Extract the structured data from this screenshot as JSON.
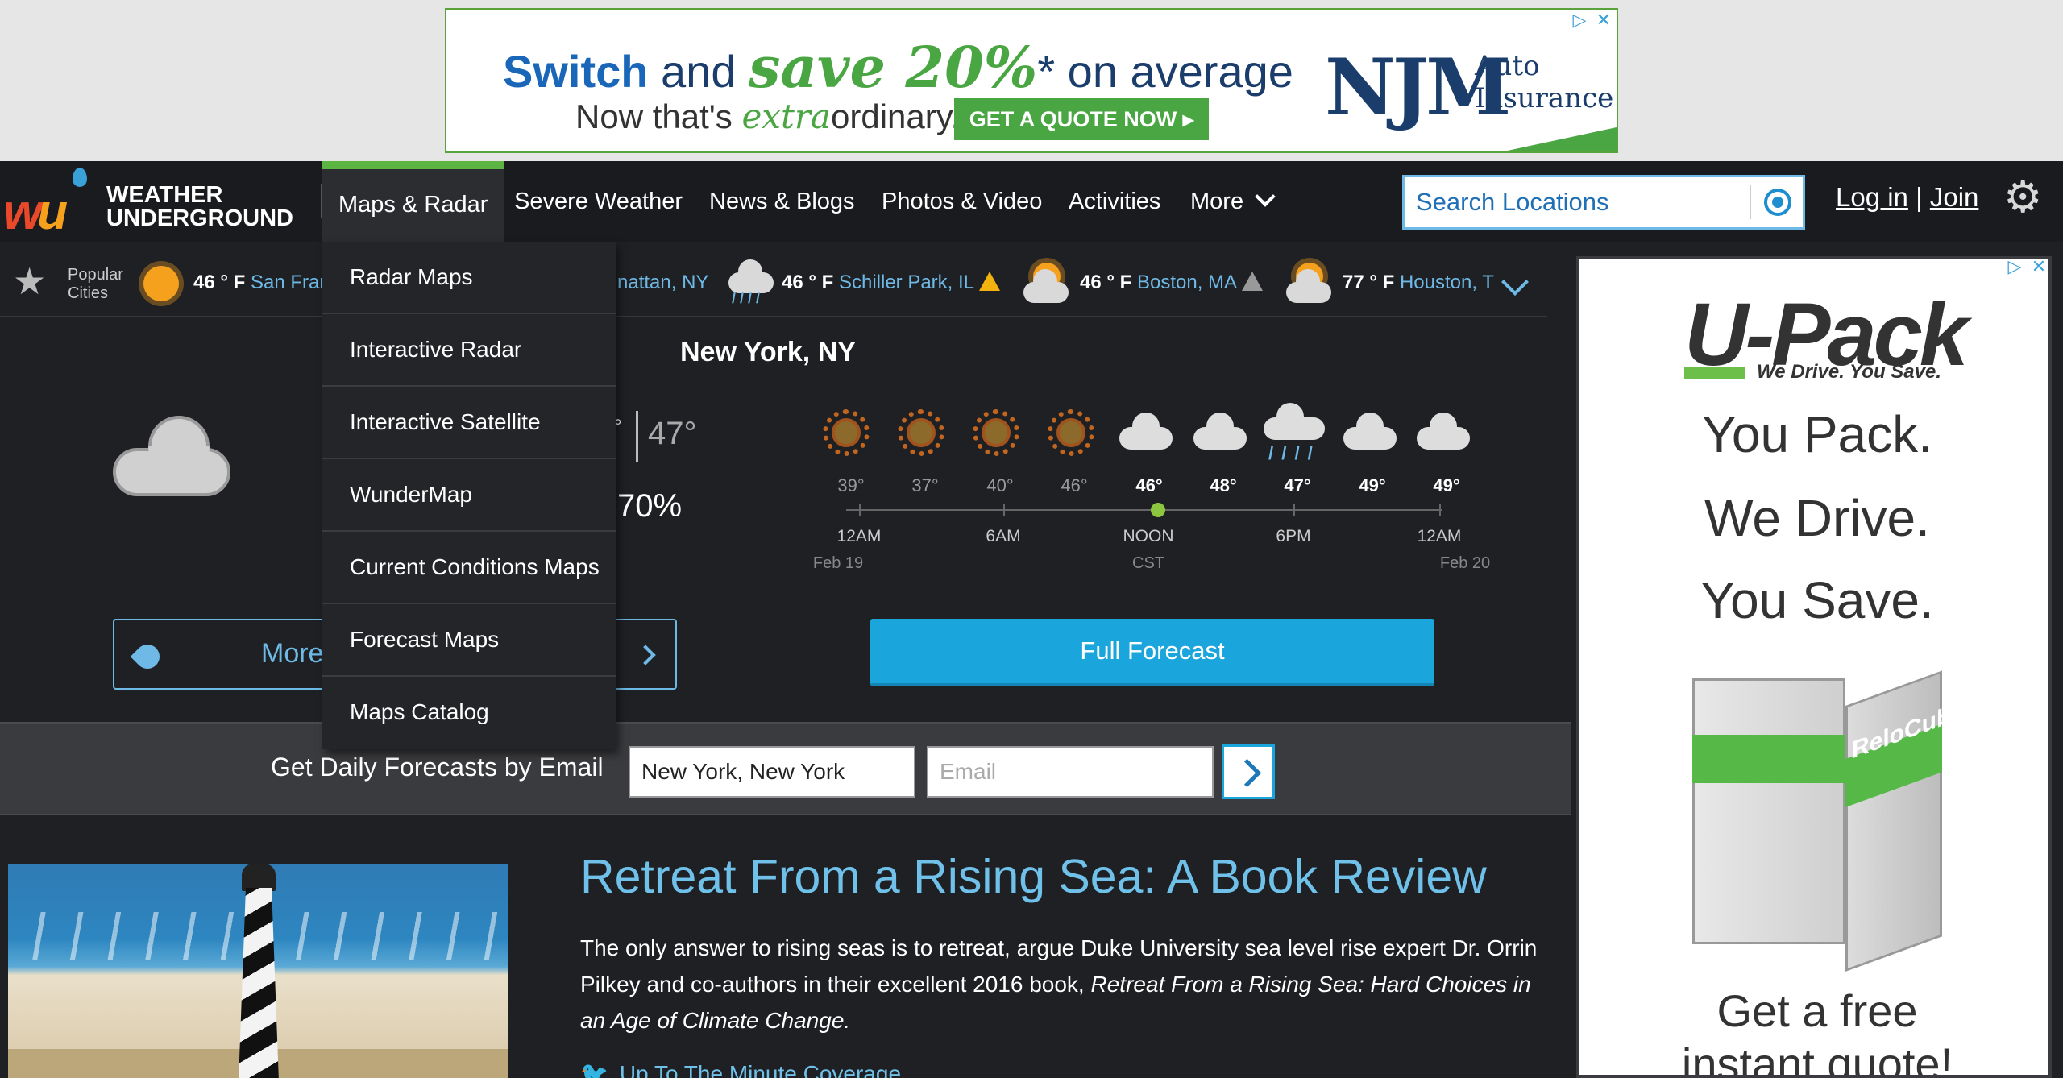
{
  "top_ad": {
    "headline_pre": "Switch",
    "headline_mid": " and ",
    "headline_save": "save 20%",
    "headline_star": "*",
    "headline_post": " on average",
    "subline_pre": "Now that's ",
    "subline_it": "extra",
    "subline_post": "ordinary.",
    "cta": "GET A QUOTE NOW ▸",
    "brand": "NJM",
    "brand_line1": "Auto",
    "brand_line2": "Insurance"
  },
  "logo": {
    "line1": "WEATHER",
    "line2": "UNDERGROUND"
  },
  "nav": {
    "items": [
      {
        "label": "Maps & Radar",
        "active": true
      },
      {
        "label": "Severe Weather"
      },
      {
        "label": "News & Blogs"
      },
      {
        "label": "Photos & Video"
      },
      {
        "label": "Activities"
      },
      {
        "label": "More"
      }
    ],
    "search_placeholder": "Search Locations",
    "login": "Log in",
    "sep": " | ",
    "join": "Join"
  },
  "popular": {
    "label_line1": "Popular",
    "label_line2": "Cities",
    "cities": [
      {
        "temp": "46 ° F",
        "name": "San Fran"
      },
      {
        "temp": "",
        "name": "nattan, NY"
      },
      {
        "temp": "46 ° F",
        "name": "Schiller Park, IL"
      },
      {
        "temp": "46 ° F",
        "name": "Boston, MA"
      },
      {
        "temp": "77 ° F",
        "name": "Houston, T"
      }
    ]
  },
  "dropdown": {
    "items": [
      "Radar Maps",
      "Interactive Radar",
      "Interactive Satellite",
      "WunderMap",
      "Current Conditions Maps",
      "Forecast Maps",
      "Maps Catalog"
    ]
  },
  "current": {
    "location": "New York, NY",
    "deg": "°",
    "low": "47°",
    "humidity": "70%",
    "more_label": "More"
  },
  "hourly": {
    "temps": [
      "39°",
      "37°",
      "40°",
      "46°",
      "46°",
      "48°",
      "47°",
      "49°",
      "49°"
    ],
    "labels": [
      "12AM",
      "6AM",
      "NOON",
      "6PM",
      "12AM"
    ],
    "sublabels": [
      "Feb 19",
      "CST",
      "Feb 20"
    ],
    "rain_glyph": "/ / / /",
    "full_forecast": "Full Forecast"
  },
  "email": {
    "label": "Get Daily Forecasts by Email",
    "location_value": "New York, New York",
    "email_placeholder": "Email"
  },
  "article": {
    "title": "Retreat From a Rising Sea: A Book Review",
    "body_plain": "The only answer to rising seas is to retreat, argue Duke University sea level rise expert Dr. Orrin Pilkey and co-authors in their excellent 2016 book, ",
    "body_italic": "Retreat From a Rising Sea: Hard Choices in an Age of Climate Change.",
    "link": "Up To The Minute Coverage"
  },
  "right_ad": {
    "brand": "U-Pack",
    "tagline": "We Drive. You Save.",
    "line1": "You Pack.",
    "line2": "We Drive.",
    "line3": "You Save.",
    "box_label": "ReloCube",
    "cta1": "Get a free",
    "cta2": "instant quote!"
  },
  "icons": {
    "ad_choices": "▷",
    "ad_close": "✕",
    "star": "★",
    "gear": "⚙",
    "bird": "🐦"
  },
  "colors": {
    "accent_blue": "#1ba5dd",
    "link_blue": "#6fc1ea",
    "nav_active": "#5cb443",
    "warning": "#f2b20f"
  }
}
